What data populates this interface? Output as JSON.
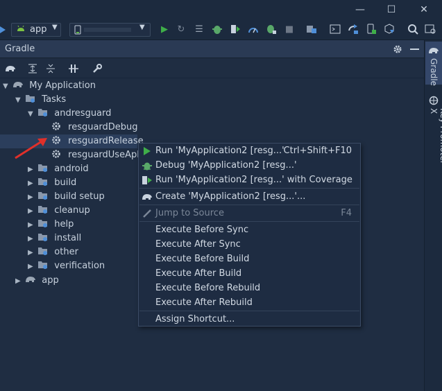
{
  "window": {
    "minimize_glyph": "—",
    "maximize_glyph": "☐",
    "close_glyph": "✕"
  },
  "toolbar": {
    "module_combo": "app",
    "device_combo": "",
    "icons": [
      "android-icon",
      "run-icon",
      "rerun-icon",
      "logcat-icon",
      "debug-icon",
      "coverage-icon",
      "profile-icon",
      "attach-debugger-icon",
      "stop-icon",
      "project-structure-icon",
      "terminal-icon",
      "sync-icon",
      "avd-manager-icon",
      "sdk-manager-icon",
      "search-icon",
      "layout-inspector-icon"
    ]
  },
  "gradle_panel": {
    "title": "Gradle",
    "settings_icon": "gear-icon",
    "hide_icon": "minimize-icon",
    "toolbar_icons": [
      "elephant-icon",
      "expand-all-icon",
      "collapse-all-icon",
      "toggle-offline-icon",
      "wrench-icon"
    ]
  },
  "tree": {
    "root": "My Application",
    "tasks": "Tasks",
    "andresguard": "andresguard",
    "andresguard_tasks": [
      "resguardDebug",
      "resguardRelease",
      "resguardUseApk"
    ],
    "groups": [
      "android",
      "build",
      "build setup",
      "cleanup",
      "help",
      "install",
      "other",
      "verification"
    ],
    "app": "app"
  },
  "right_sidebar": {
    "gradle_tab": "Gradle",
    "key_promoter_tab": "Key Promoter X"
  },
  "context_menu": {
    "items": [
      {
        "label": "Run 'MyApplication2 [resg...'",
        "shortcut": "Ctrl+Shift+F10",
        "icon": "run-icon"
      },
      {
        "label": "Debug 'MyApplication2 [resg...'",
        "shortcut": "",
        "icon": "debug-icon"
      },
      {
        "label": "Run 'MyApplication2 [resg...' with Coverage",
        "shortcut": "",
        "icon": "coverage-icon"
      },
      {
        "label": "Create 'MyApplication2 [resg...'...",
        "shortcut": "",
        "icon": "elephant-icon"
      },
      {
        "label": "Jump to Source",
        "shortcut": "F4",
        "icon": "pencil-icon"
      },
      {
        "label": "Execute Before Sync",
        "shortcut": ""
      },
      {
        "label": "Execute After Sync",
        "shortcut": ""
      },
      {
        "label": "Execute Before Build",
        "shortcut": ""
      },
      {
        "label": "Execute After Build",
        "shortcut": ""
      },
      {
        "label": "Execute Before Rebuild",
        "shortcut": ""
      },
      {
        "label": "Execute After Rebuild",
        "shortcut": ""
      },
      {
        "label": "Assign Shortcut...",
        "shortcut": ""
      }
    ]
  },
  "colors": {
    "accent_run": "#3fae49",
    "debug_green": "#59a869",
    "annotation_red": "#e0302a",
    "selection": "#2b3e5c"
  }
}
